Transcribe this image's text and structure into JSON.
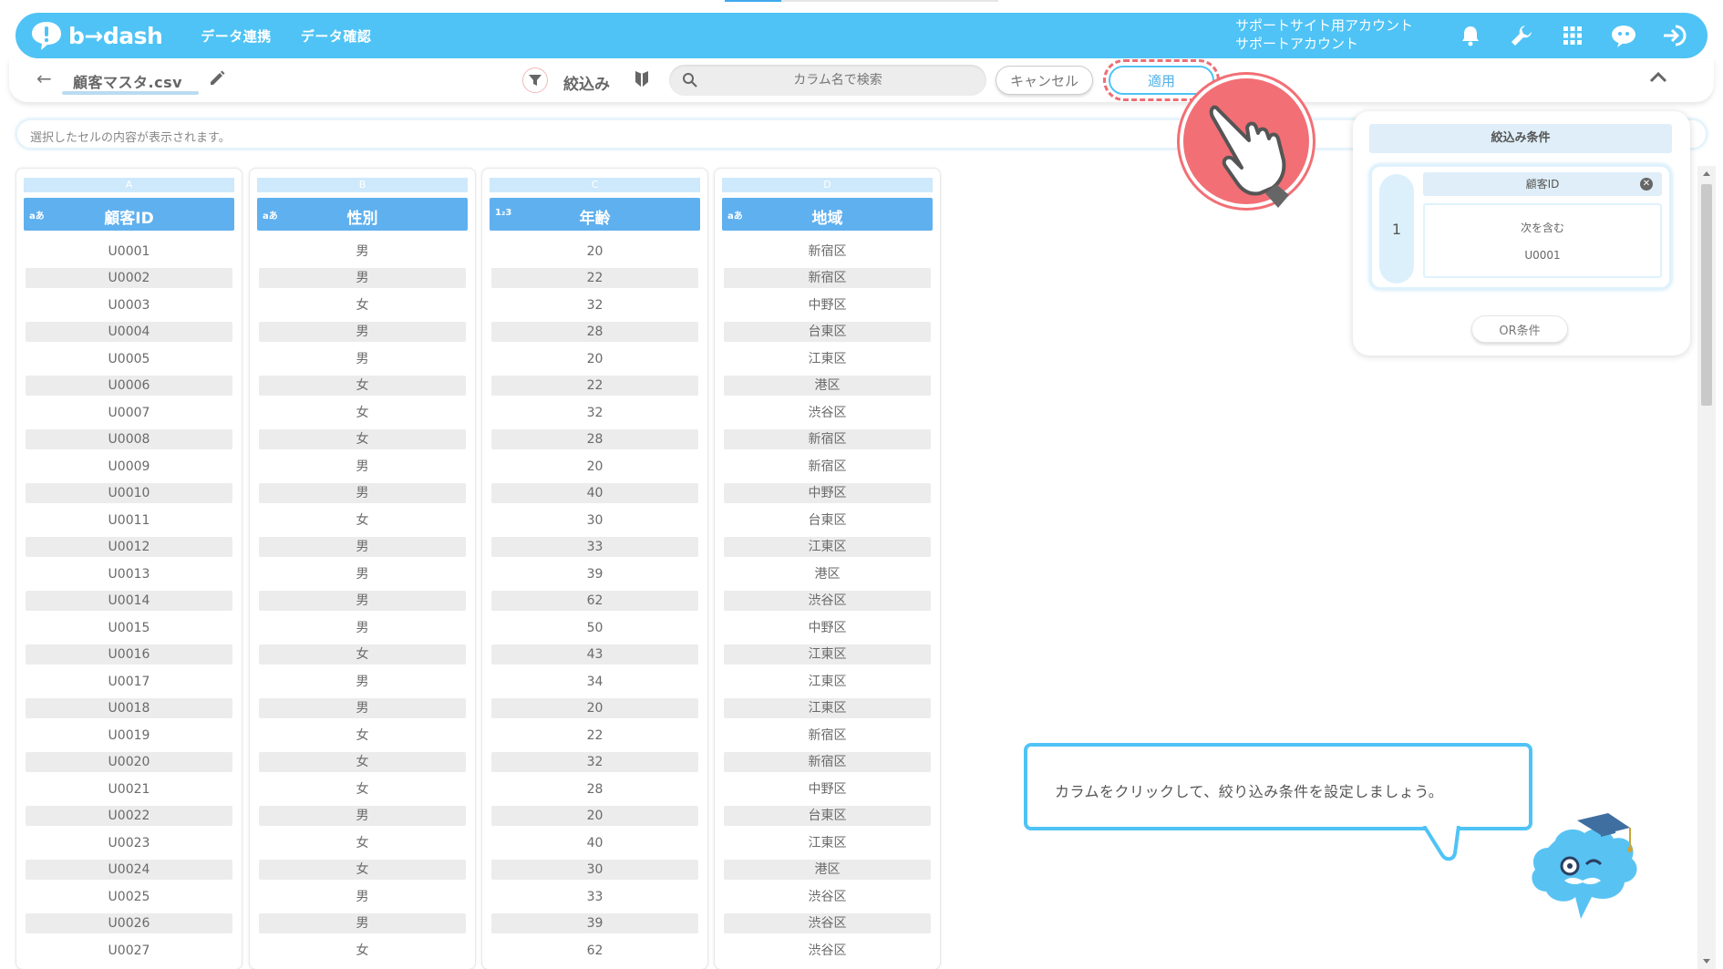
{
  "header": {
    "logo_text": "b→dash",
    "nav": [
      "データ連携",
      "データ確認"
    ],
    "account_line1": "サポートサイト用アカウント",
    "account_line2": "サポートアカウント",
    "icons": [
      "bell-icon",
      "wrench-icon",
      "grid-icon",
      "chat-icon",
      "logout-icon"
    ],
    "accent_color": "#4fc3f5"
  },
  "toolbar": {
    "file_name": "顧客マスタ.csv",
    "filter_label": "絞込み",
    "search_placeholder": "カラム名で検索",
    "cancel_label": "キャンセル",
    "apply_label": "適用"
  },
  "cell_bar": {
    "placeholder": "選択したセルの内容が表示されます。"
  },
  "columns": [
    {
      "letter": "A",
      "type": "aあ",
      "name": "顧客ID"
    },
    {
      "letter": "B",
      "type": "aあ",
      "name": "性別"
    },
    {
      "letter": "C",
      "type": "1₂3",
      "name": "年齢"
    },
    {
      "letter": "D",
      "type": "aあ",
      "name": "地域"
    }
  ],
  "table_rows": [
    [
      "U0001",
      "男",
      "20",
      "新宿区"
    ],
    [
      "U0002",
      "男",
      "22",
      "新宿区"
    ],
    [
      "U0003",
      "女",
      "32",
      "中野区"
    ],
    [
      "U0004",
      "男",
      "28",
      "台東区"
    ],
    [
      "U0005",
      "男",
      "20",
      "江東区"
    ],
    [
      "U0006",
      "女",
      "22",
      "港区"
    ],
    [
      "U0007",
      "女",
      "32",
      "渋谷区"
    ],
    [
      "U0008",
      "女",
      "28",
      "新宿区"
    ],
    [
      "U0009",
      "男",
      "20",
      "新宿区"
    ],
    [
      "U0010",
      "男",
      "40",
      "中野区"
    ],
    [
      "U0011",
      "女",
      "30",
      "台東区"
    ],
    [
      "U0012",
      "男",
      "33",
      "江東区"
    ],
    [
      "U0013",
      "男",
      "39",
      "港区"
    ],
    [
      "U0014",
      "男",
      "62",
      "渋谷区"
    ],
    [
      "U0015",
      "男",
      "50",
      "中野区"
    ],
    [
      "U0016",
      "女",
      "43",
      "江東区"
    ],
    [
      "U0017",
      "男",
      "34",
      "江東区"
    ],
    [
      "U0018",
      "男",
      "20",
      "江東区"
    ],
    [
      "U0019",
      "女",
      "22",
      "新宿区"
    ],
    [
      "U0020",
      "女",
      "32",
      "新宿区"
    ],
    [
      "U0021",
      "女",
      "28",
      "中野区"
    ],
    [
      "U0022",
      "男",
      "20",
      "台東区"
    ],
    [
      "U0023",
      "女",
      "40",
      "江東区"
    ],
    [
      "U0024",
      "女",
      "30",
      "港区"
    ],
    [
      "U0025",
      "男",
      "33",
      "渋谷区"
    ],
    [
      "U0026",
      "男",
      "39",
      "渋谷区"
    ],
    [
      "U0027",
      "女",
      "62",
      "渋谷区"
    ]
  ],
  "filter_panel": {
    "title": "絞込み条件",
    "conditions": [
      {
        "index": "1",
        "column": "顧客ID",
        "operator": "次を含む",
        "value": "U0001"
      }
    ],
    "or_label": "OR条件"
  },
  "tooltip": {
    "text": "カラムをクリックして、絞り込み条件を設定しましょう。"
  }
}
